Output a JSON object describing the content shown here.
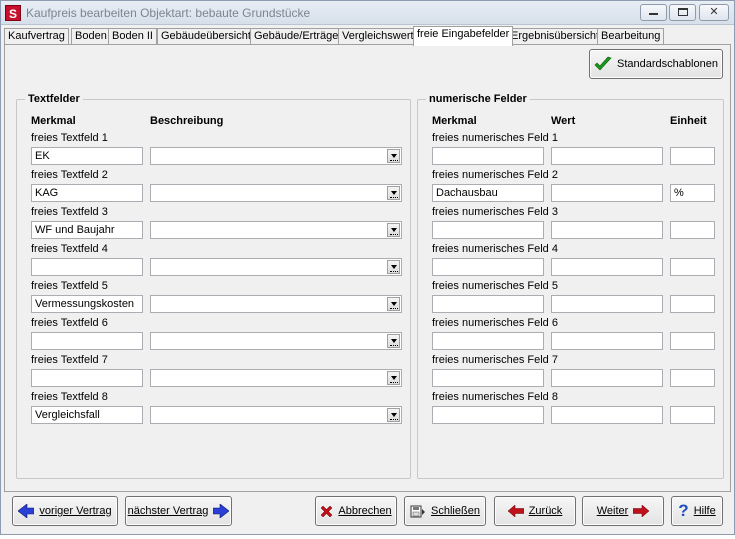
{
  "window": {
    "app_icon_letter": "S",
    "title": "Kaufpreis bearbeiten  Objektart: bebaute Grundstücke"
  },
  "tabs": [
    {
      "label": "Kaufvertrag",
      "active": false
    },
    {
      "label": "Boden",
      "active": false
    },
    {
      "label": "Boden II",
      "active": false
    },
    {
      "label": "Gebäudeübersicht",
      "active": false
    },
    {
      "label": "Gebäude/Erträge",
      "active": false
    },
    {
      "label": "Vergleichswert",
      "active": false
    },
    {
      "label": "freie Eingabefelder",
      "active": true
    },
    {
      "label": "Ergebnisübersicht",
      "active": false
    },
    {
      "label": "Bearbeitung",
      "active": false
    }
  ],
  "toolbar": {
    "standard_templates_label": "Standardschablonen"
  },
  "text_fields": {
    "group_title": "Textfelder",
    "col_feature": "Merkmal",
    "col_description": "Beschreibung",
    "rows": [
      {
        "label": "freies Textfeld 1",
        "value": "EK",
        "description": ""
      },
      {
        "label": "freies Textfeld 2",
        "value": "KAG",
        "description": ""
      },
      {
        "label": "freies Textfeld 3",
        "value": "WF und Baujahr",
        "description": ""
      },
      {
        "label": "freies Textfeld 4",
        "value": "",
        "description": ""
      },
      {
        "label": "freies Textfeld 5",
        "value": "Vermessungskosten",
        "description": ""
      },
      {
        "label": "freies Textfeld 6",
        "value": "",
        "description": ""
      },
      {
        "label": "freies Textfeld 7",
        "value": "",
        "description": ""
      },
      {
        "label": "freies Textfeld 8",
        "value": "Vergleichsfall",
        "description": ""
      }
    ]
  },
  "numeric_fields": {
    "group_title": "numerische Felder",
    "col_feature": "Merkmal",
    "col_value": "Wert",
    "col_unit": "Einheit",
    "rows": [
      {
        "label": "freies numerisches Feld 1",
        "feature": "",
        "value": "",
        "unit": ""
      },
      {
        "label": "freies numerisches Feld 2",
        "feature": "Dachausbau",
        "value": "",
        "unit": "%"
      },
      {
        "label": "freies numerisches Feld 3",
        "feature": "",
        "value": "",
        "unit": ""
      },
      {
        "label": "freies numerisches Feld 4",
        "feature": "",
        "value": "",
        "unit": ""
      },
      {
        "label": "freies numerisches Feld 5",
        "feature": "",
        "value": "",
        "unit": ""
      },
      {
        "label": "freies numerisches Feld 6",
        "feature": "",
        "value": "",
        "unit": ""
      },
      {
        "label": "freies numerisches Feld 7",
        "feature": "",
        "value": "",
        "unit": ""
      },
      {
        "label": "freies numerisches Feld 8",
        "feature": "",
        "value": "",
        "unit": ""
      }
    ]
  },
  "bottom": {
    "prev_label": "voriger Vertrag",
    "next_label": "nächster Vertrag",
    "cancel_label": "Abbrechen",
    "close_label": "Schließen",
    "back_label": "Zurück",
    "forward_label": "Weiter",
    "help_label": "Hilfe"
  },
  "colors": {
    "arrow_blue": "#2a3fd6",
    "arrow_red": "#c0101a",
    "check_green": "#1a9a1a",
    "help_blue": "#1f4fbf"
  }
}
